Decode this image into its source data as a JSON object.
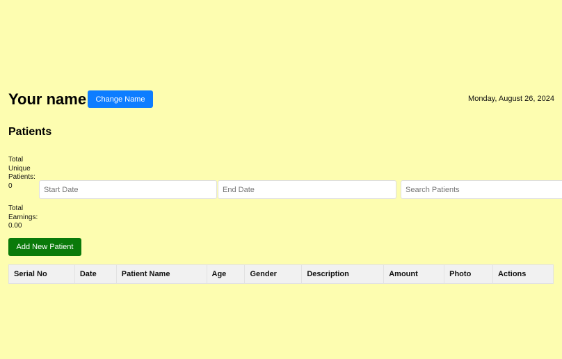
{
  "header": {
    "user_name": "Your name",
    "change_name_label": "Change Name",
    "date": "Monday, August 26, 2024"
  },
  "section_title": "Patients",
  "stats": {
    "total_unique_patients_label": "Total Unique Patients:",
    "total_unique_patients_value": "0",
    "total_earnings_label": "Total Earnings:",
    "total_earnings_value": "0.00"
  },
  "filters": {
    "start_date_placeholder": "Start Date",
    "end_date_placeholder": "End Date",
    "search_placeholder": "Search Patients"
  },
  "add_patient_label": "Add New Patient",
  "table": {
    "columns": [
      "Serial No",
      "Date",
      "Patient Name",
      "Age",
      "Gender",
      "Description",
      "Amount",
      "Photo",
      "Actions"
    ],
    "rows": []
  },
  "colors": {
    "page_background": "#fdfdb0",
    "primary_button": "#0d7dff",
    "success_button": "#0a7a0a"
  }
}
